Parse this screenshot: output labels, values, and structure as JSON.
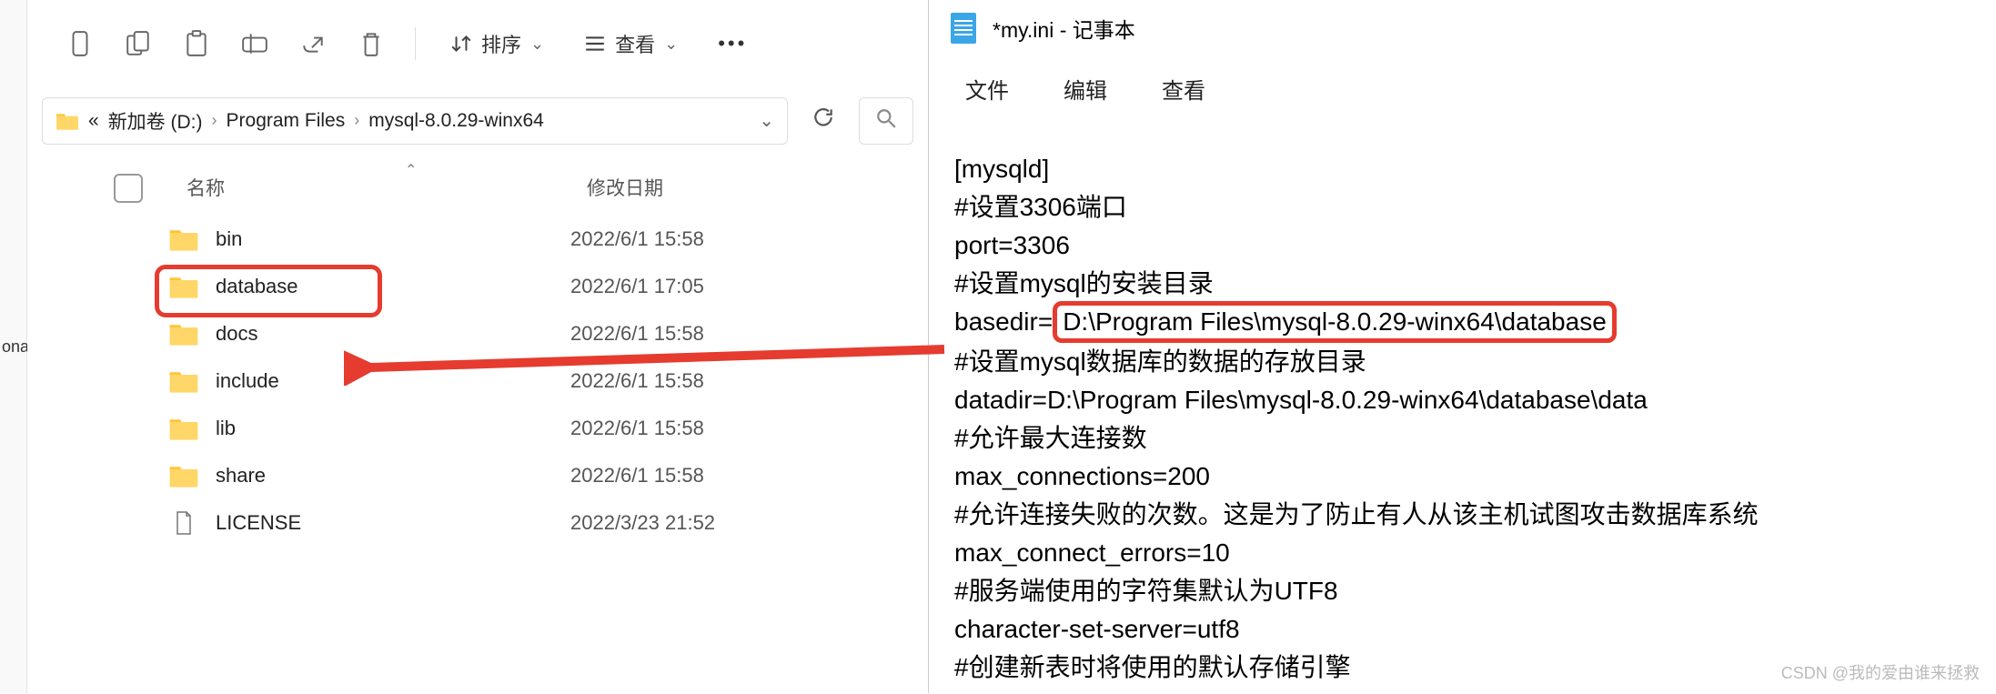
{
  "left_cut_text": "onal",
  "toolbar": {
    "sort_label": "排序",
    "view_label": "查看"
  },
  "breadcrumb": {
    "prefix": "«",
    "parts": [
      "新加卷 (D:)",
      "Program Files",
      "mysql-8.0.29-winx64"
    ]
  },
  "headers": {
    "name": "名称",
    "date": "修改日期"
  },
  "files": [
    {
      "name": "bin",
      "date": "2022/6/1 15:58",
      "type": "folder"
    },
    {
      "name": "database",
      "date": "2022/6/1 17:05",
      "type": "folder",
      "highlighted": true
    },
    {
      "name": "docs",
      "date": "2022/6/1 15:58",
      "type": "folder"
    },
    {
      "name": "include",
      "date": "2022/6/1 15:58",
      "type": "folder"
    },
    {
      "name": "lib",
      "date": "2022/6/1 15:58",
      "type": "folder"
    },
    {
      "name": "share",
      "date": "2022/6/1 15:58",
      "type": "folder"
    },
    {
      "name": "LICENSE",
      "date": "2022/3/23 21:52",
      "type": "file"
    }
  ],
  "notepad": {
    "title": "*my.ini - 记事本",
    "menu": [
      "文件",
      "编辑",
      "查看"
    ],
    "lines": [
      "[mysqld]",
      "#设置3306端口",
      "port=3306",
      "#设置mysql的安装目录",
      {
        "prefix": "basedir=",
        "boxed": "D:\\Program Files\\mysql-8.0.29-winx64\\database"
      },
      "#设置mysql数据库的数据的存放目录",
      "datadir=D:\\Program Files\\mysql-8.0.29-winx64\\database\\data",
      "#允许最大连接数",
      "max_connections=200",
      "#允许连接失败的次数。这是为了防止有人从该主机试图攻击数据库系统",
      "max_connect_errors=10",
      "#服务端使用的字符集默认为UTF8",
      "character-set-server=utf8",
      "#创建新表时将使用的默认存储引擎"
    ]
  },
  "watermark": "CSDN @我的爱由谁来拯救"
}
